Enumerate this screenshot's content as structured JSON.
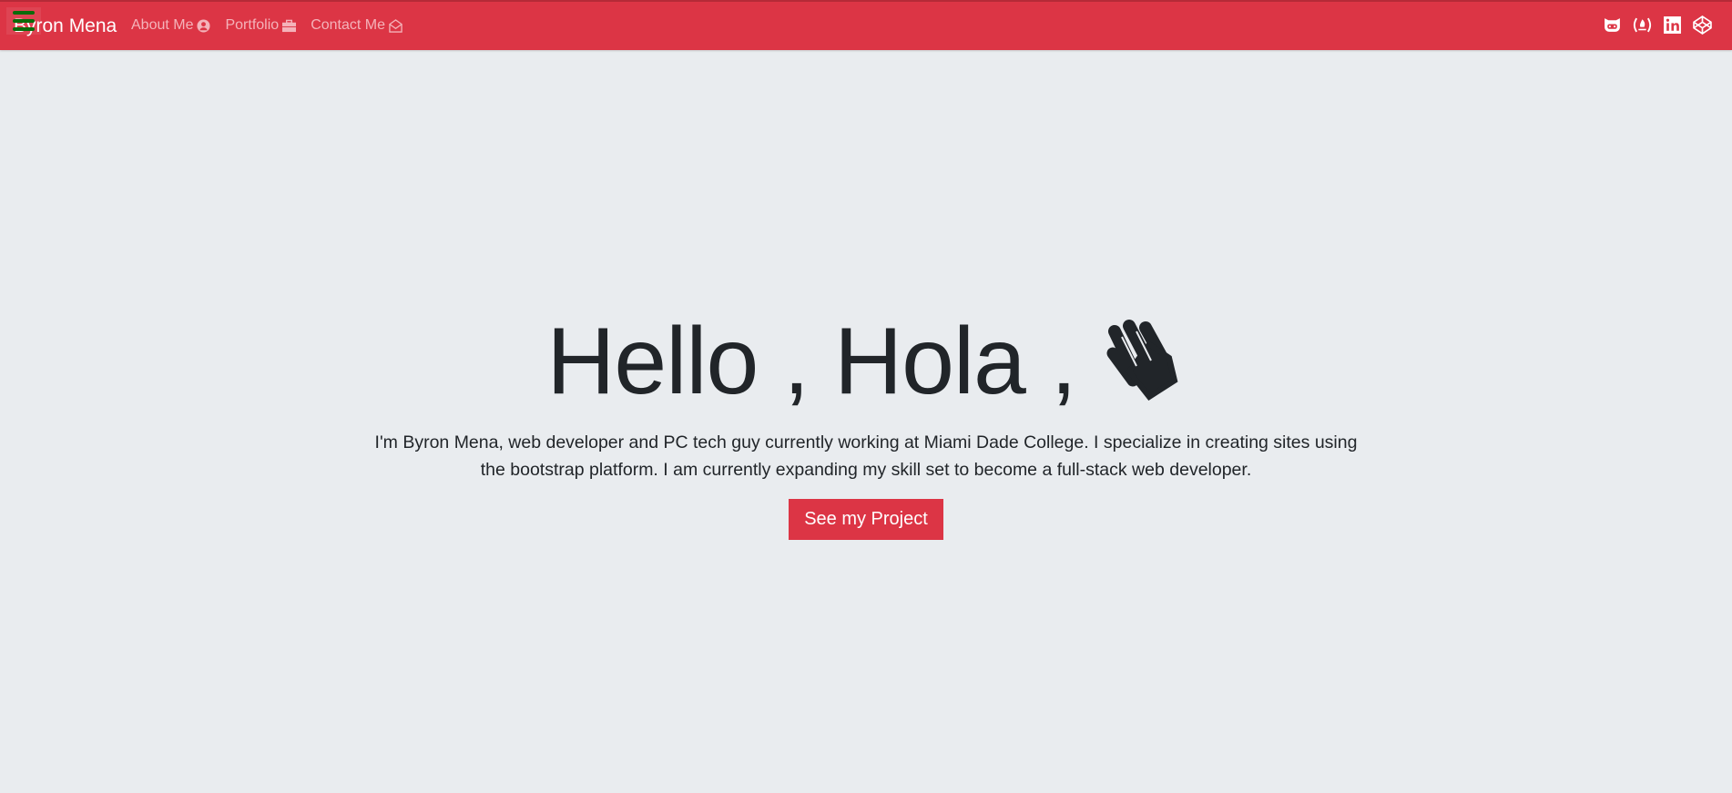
{
  "navbar": {
    "brand": "Byron Mena",
    "links": [
      {
        "label": "About Me",
        "icon": "user-circle-icon"
      },
      {
        "label": "Portfolio",
        "icon": "briefcase-icon"
      },
      {
        "label": "Contact Me",
        "icon": "envelope-open-icon"
      }
    ],
    "social": [
      "github-icon",
      "freecodecamp-icon",
      "linkedin-icon",
      "codepen-icon"
    ],
    "bg_color": "#dc3545"
  },
  "hero": {
    "heading": "Hello , Hola ,",
    "heading_icon": "waving-hand-icon",
    "text": "I'm Byron Mena, web developer and PC tech guy currently working at Miami Dade College. I specialize in creating sites using the bootstrap platform. I am currently expanding my skill set to become a full-stack web developer.",
    "button": "See my Project"
  }
}
